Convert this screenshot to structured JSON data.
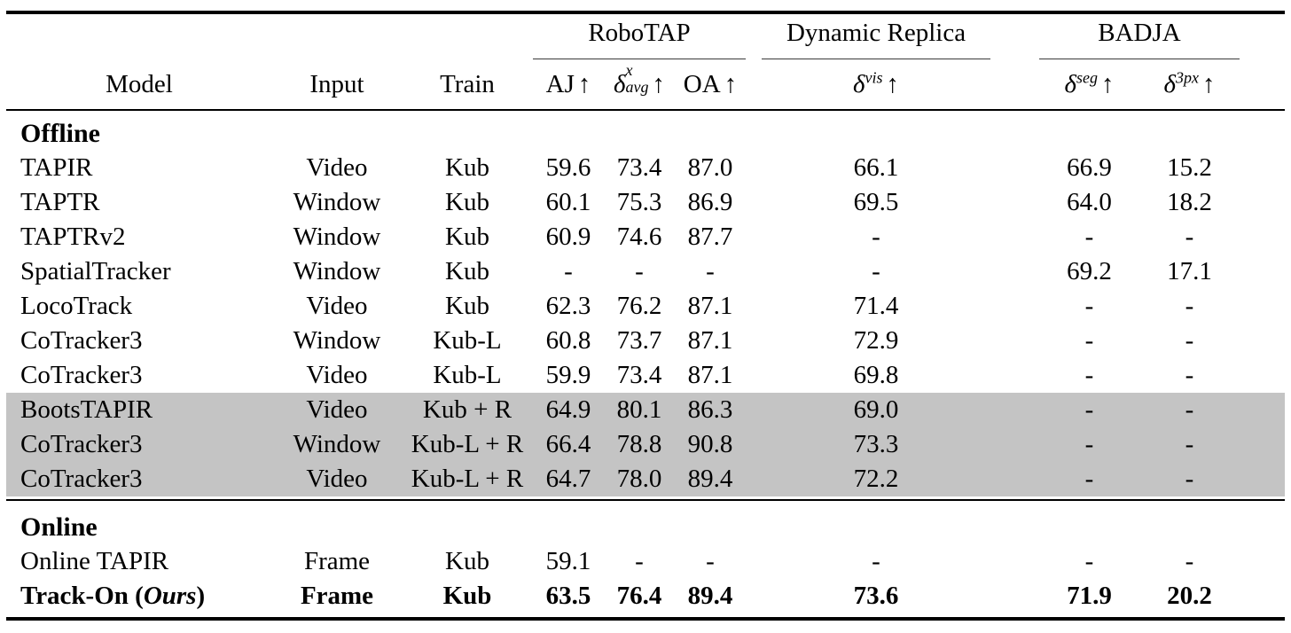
{
  "table": {
    "columns": {
      "model": "Model",
      "input": "Input",
      "train": "Train"
    },
    "groups": [
      {
        "name": "RoboTAP",
        "span": 3
      },
      {
        "name": "Dynamic Replica",
        "span": 1
      },
      {
        "name": "BADJA",
        "span": 2
      }
    ],
    "metrics": [
      {
        "id": "aj",
        "base": "AJ",
        "sup": "",
        "sub": "",
        "arrow": "↑"
      },
      {
        "id": "davg",
        "base": "δ",
        "sup": "x",
        "sub": "avg",
        "arrow": "↑"
      },
      {
        "id": "oa",
        "base": "OA",
        "sup": "",
        "sub": "",
        "arrow": "↑"
      },
      {
        "id": "dvis",
        "base": "δ",
        "sup": "vis",
        "sub": "",
        "arrow": "↑"
      },
      {
        "id": "dseg",
        "base": "δ",
        "sup": "seg",
        "sub": "",
        "arrow": "↑"
      },
      {
        "id": "d3px",
        "base": "δ",
        "sup": "3px",
        "sub": "",
        "arrow": "↑"
      }
    ],
    "sections": [
      {
        "title": "Offline",
        "rows": [
          {
            "model": "TAPIR",
            "input": "Video",
            "train": "Kub",
            "aj": "59.6",
            "davg": "73.4",
            "oa": "87.0",
            "dvis": "66.1",
            "dseg": "66.9",
            "d3px": "15.2",
            "highlight": false,
            "bold": false
          },
          {
            "model": "TAPTR",
            "input": "Window",
            "train": "Kub",
            "aj": "60.1",
            "davg": "75.3",
            "oa": "86.9",
            "dvis": "69.5",
            "dseg": "64.0",
            "d3px": "18.2",
            "highlight": false,
            "bold": false
          },
          {
            "model": "TAPTRv2",
            "input": "Window",
            "train": "Kub",
            "aj": "60.9",
            "davg": "74.6",
            "oa": "87.7",
            "dvis": "-",
            "dseg": "-",
            "d3px": "-",
            "highlight": false,
            "bold": false
          },
          {
            "model": "SpatialTracker",
            "input": "Window",
            "train": "Kub",
            "aj": "-",
            "davg": "-",
            "oa": "-",
            "dvis": "-",
            "dseg": "69.2",
            "d3px": "17.1",
            "highlight": false,
            "bold": false
          },
          {
            "model": "LocoTrack",
            "input": "Video",
            "train": "Kub",
            "aj": "62.3",
            "davg": "76.2",
            "oa": "87.1",
            "dvis": "71.4",
            "dseg": "-",
            "d3px": "-",
            "highlight": false,
            "bold": false
          },
          {
            "model": "CoTracker3",
            "input": "Window",
            "train": "Kub-L",
            "aj": "60.8",
            "davg": "73.7",
            "oa": "87.1",
            "dvis": "72.9",
            "dseg": "-",
            "d3px": "-",
            "highlight": false,
            "bold": false
          },
          {
            "model": "CoTracker3",
            "input": "Video",
            "train": "Kub-L",
            "aj": "59.9",
            "davg": "73.4",
            "oa": "87.1",
            "dvis": "69.8",
            "dseg": "-",
            "d3px": "-",
            "highlight": false,
            "bold": false
          },
          {
            "model": "BootsTAPIR",
            "input": "Video",
            "train": "Kub + R",
            "aj": "64.9",
            "davg": "80.1",
            "oa": "86.3",
            "dvis": "69.0",
            "dseg": "-",
            "d3px": "-",
            "highlight": true,
            "bold": false
          },
          {
            "model": "CoTracker3",
            "input": "Window",
            "train": "Kub-L + R",
            "aj": "66.4",
            "davg": "78.8",
            "oa": "90.8",
            "dvis": "73.3",
            "dseg": "-",
            "d3px": "-",
            "highlight": true,
            "bold": false
          },
          {
            "model": "CoTracker3",
            "input": "Video",
            "train": "Kub-L + R",
            "aj": "64.7",
            "davg": "78.0",
            "oa": "89.4",
            "dvis": "72.2",
            "dseg": "-",
            "d3px": "-",
            "highlight": true,
            "bold": false
          }
        ]
      },
      {
        "title": "Online",
        "rows": [
          {
            "model": "Online TAPIR",
            "input": "Frame",
            "train": "Kub",
            "aj": "59.1",
            "davg": "-",
            "oa": "-",
            "dvis": "-",
            "dseg": "-",
            "d3px": "-",
            "highlight": false,
            "bold": false
          },
          {
            "model": "Track-On",
            "model_suffix": "(Ours)",
            "input": "Frame",
            "train": "Kub",
            "aj": "63.5",
            "davg": "76.4",
            "oa": "89.4",
            "dvis": "73.6",
            "dseg": "71.9",
            "d3px": "20.2",
            "highlight": false,
            "bold": true
          }
        ]
      }
    ],
    "highlight_color": "#c4c4c4"
  }
}
